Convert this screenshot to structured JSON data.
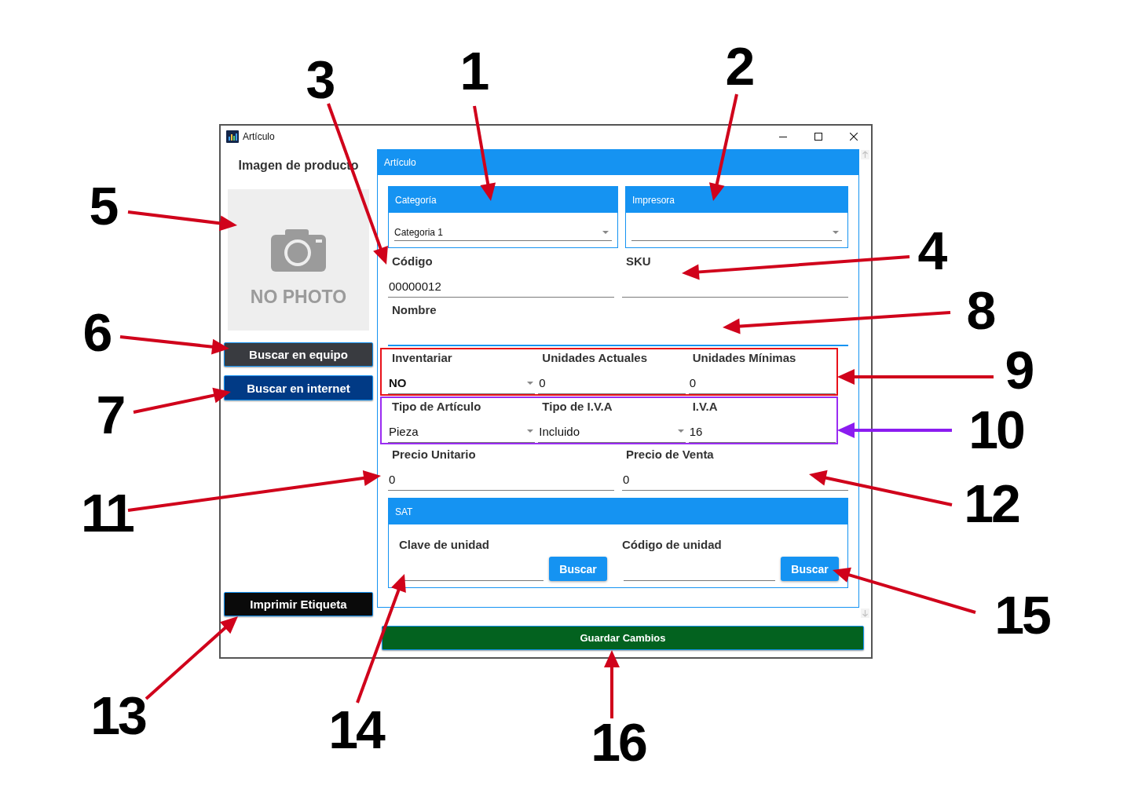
{
  "window": {
    "title": "Artículo"
  },
  "image_panel": {
    "heading": "Imagen de producto",
    "photo_caption": "NO PHOTO",
    "buttons": [
      {
        "label": "Buscar en equipo",
        "kind": "dark"
      },
      {
        "label": "Buscar en internet",
        "kind": "navy"
      }
    ],
    "print_button": {
      "label": "Imprimir Etiqueta"
    }
  },
  "form": {
    "title": "Artículo",
    "selectors": [
      {
        "title": "Categoría",
        "value": "Categoria 1"
      },
      {
        "title": "Impresora"
      }
    ],
    "rows": [
      {
        "fields": [
          {
            "label": "Código",
            "kind": "text",
            "value": "00000012",
            "focused": false
          },
          {
            "label": "SKU",
            "kind": "text",
            "focused": false
          }
        ]
      },
      {
        "fields": [
          {
            "label": "Nombre",
            "kind": "text",
            "focused": true
          }
        ]
      },
      {
        "color": "#e8111a",
        "fields": [
          {
            "label": "Inventariar",
            "kind": "toggle",
            "value": "NO",
            "focused": false
          },
          {
            "label": "Unidades Actuales",
            "kind": "text",
            "value": "0",
            "focused": false
          },
          {
            "label": "Unidades Mínimas",
            "kind": "text",
            "value": "0",
            "focused": false
          }
        ]
      },
      {
        "color": "#9a2cf2",
        "fields": [
          {
            "label": "Tipo de Artículo",
            "kind": "select",
            "value": "Pieza",
            "focused": false
          },
          {
            "label": "Tipo de I.V.A",
            "kind": "select",
            "value": "Incluido",
            "focused": false
          },
          {
            "label": "I.V.A",
            "kind": "text",
            "value": "16",
            "focused": false
          }
        ]
      },
      {
        "fields": [
          {
            "label": "Precio Unitario",
            "kind": "text",
            "value": "0",
            "focused": false
          },
          {
            "label": "Precio de Venta",
            "kind": "text",
            "value": "0",
            "focused": false
          }
        ]
      }
    ],
    "sat": {
      "title": "SAT",
      "fields": [
        {
          "label": "Clave de unidad",
          "button": "Buscar"
        },
        {
          "label": "Código de unidad",
          "button": "Buscar"
        }
      ]
    }
  },
  "save_button": {
    "label": "Guardar Cambios"
  },
  "callouts": [
    {
      "label": "3",
      "color": "#d0021b"
    },
    {
      "label": "1",
      "color": "#d0021b"
    },
    {
      "label": "2",
      "color": "#d0021b"
    },
    {
      "label": "5",
      "color": "#d0021b"
    },
    {
      "label": "4",
      "color": "#d0021b"
    },
    {
      "label": "8",
      "color": "#d0021b"
    },
    {
      "label": "6",
      "color": "#d0021b"
    },
    {
      "label": "9",
      "color": "#d0021b"
    },
    {
      "label": "7",
      "color": "#d0021b"
    },
    {
      "label": "10",
      "color": "#8b1cf0"
    },
    {
      "label": "11",
      "color": "#d0021b"
    },
    {
      "label": "12",
      "color": "#d0021b"
    },
    {
      "label": "15",
      "color": "#d0021b"
    },
    {
      "label": "13",
      "color": "#d0021b"
    },
    {
      "label": "14",
      "color": "#d0021b"
    },
    {
      "label": "16",
      "color": "#d0021b"
    }
  ]
}
